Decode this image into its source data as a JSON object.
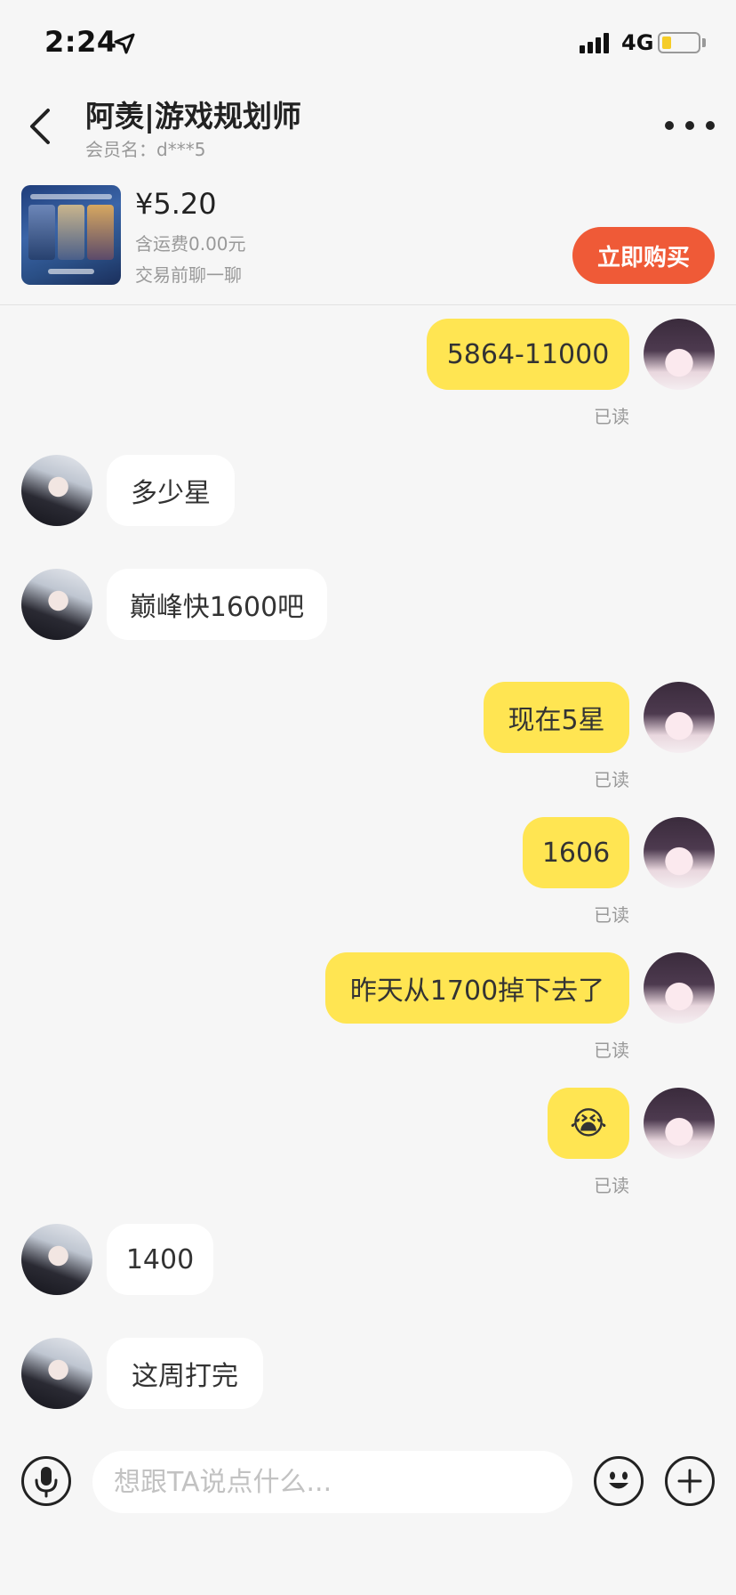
{
  "status_bar": {
    "time": "2:24",
    "network": "4G",
    "battery_level": 0.25,
    "signal_bars": 4
  },
  "header": {
    "title": "阿羡|游戏规划师",
    "subtitle": "会员名：d***5"
  },
  "product": {
    "price": "¥5.20",
    "shipping": "含运费0.00元",
    "note": "交易前聊一聊",
    "buy_label": "立即购买"
  },
  "messages": [
    {
      "from": "me",
      "text": "5864-11000",
      "status": "已读"
    },
    {
      "from": "them",
      "text": "多少星"
    },
    {
      "from": "them",
      "text": "巅峰快1600吧"
    },
    {
      "from": "me",
      "text": "现在5星",
      "status": "已读"
    },
    {
      "from": "me",
      "text": "1606",
      "status": "已读"
    },
    {
      "from": "me",
      "text": "昨天从1700掉下去了",
      "status": "已读"
    },
    {
      "from": "me",
      "text": "😭",
      "status": "已读"
    },
    {
      "from": "them",
      "text": "1400"
    },
    {
      "from": "them",
      "text": "这周打完"
    }
  ],
  "input": {
    "placeholder": "想跟TA说点什么..."
  },
  "icons": {
    "back": "chevron-left-icon",
    "more": "more-dots-icon",
    "mic": "microphone-icon",
    "emoji": "emoji-icon",
    "plus": "plus-icon",
    "location": "location-arrow-icon"
  },
  "colors": {
    "me_bubble": "#ffe552",
    "them_bubble": "#ffffff",
    "buy_button": "#ef5a37",
    "background": "#f6f6f6"
  }
}
